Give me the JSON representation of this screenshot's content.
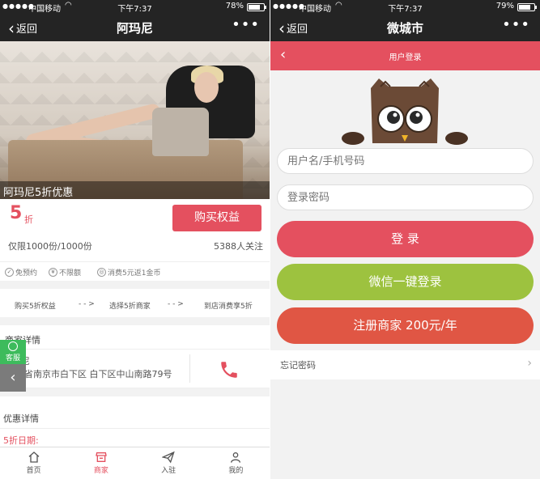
{
  "status_left": {
    "carrier": "中国移动",
    "time": "下午7:37",
    "battery": "78%",
    "battery_level": 0.78
  },
  "status_right": {
    "carrier": "中国移动",
    "time": "下午7:37",
    "battery": "79%",
    "battery_level": 0.79
  },
  "nav_left": {
    "back_label": "返回",
    "title": "阿玛尼",
    "more": "•••"
  },
  "nav_right": {
    "back_label": "返回",
    "title": "微城市",
    "more": "•••"
  },
  "deal": {
    "banner_caption": "阿玛尼5折优惠",
    "price": "5",
    "price_unit": "折",
    "buy_button": "购买权益",
    "limit": "仅限1000份/1000份",
    "followers": "5388人关注",
    "features": [
      "免预约",
      "不限额",
      "消费5元返1金币"
    ],
    "steps": [
      "购买5折权益",
      "- - >",
      "选择5折商家",
      "- - >",
      "到店消费享5折"
    ],
    "merchant_section": "商家详情",
    "merchant_name": "尼",
    "merchant_address": "江苏省南京市白下区 白下区中山南路79号",
    "coupon_section": "优惠详情",
    "date_label": "5折日期:"
  },
  "float": {
    "service_label": "客服",
    "back_arrow": "‹"
  },
  "tabs": [
    {
      "label": "首页",
      "icon": "home-icon",
      "active": false
    },
    {
      "label": "商家",
      "icon": "shop-icon",
      "active": true
    },
    {
      "label": "入驻",
      "icon": "send-icon",
      "active": false
    },
    {
      "label": "我的",
      "icon": "person-icon",
      "active": false
    }
  ],
  "login": {
    "header_title": "用户登录",
    "username_placeholder": "用户名/手机号码",
    "password_placeholder": "登录密码",
    "login_button": "登 录",
    "wechat_button": "微信一键登录",
    "register_button": "注册商家 200元/年",
    "forgot_label": "忘记密码"
  },
  "colors": {
    "accent": "#e4505f",
    "wechat_green": "#9dc23f",
    "register_red": "#e05644",
    "service_green": "#3dbb5c",
    "bar_dark": "#242424"
  }
}
